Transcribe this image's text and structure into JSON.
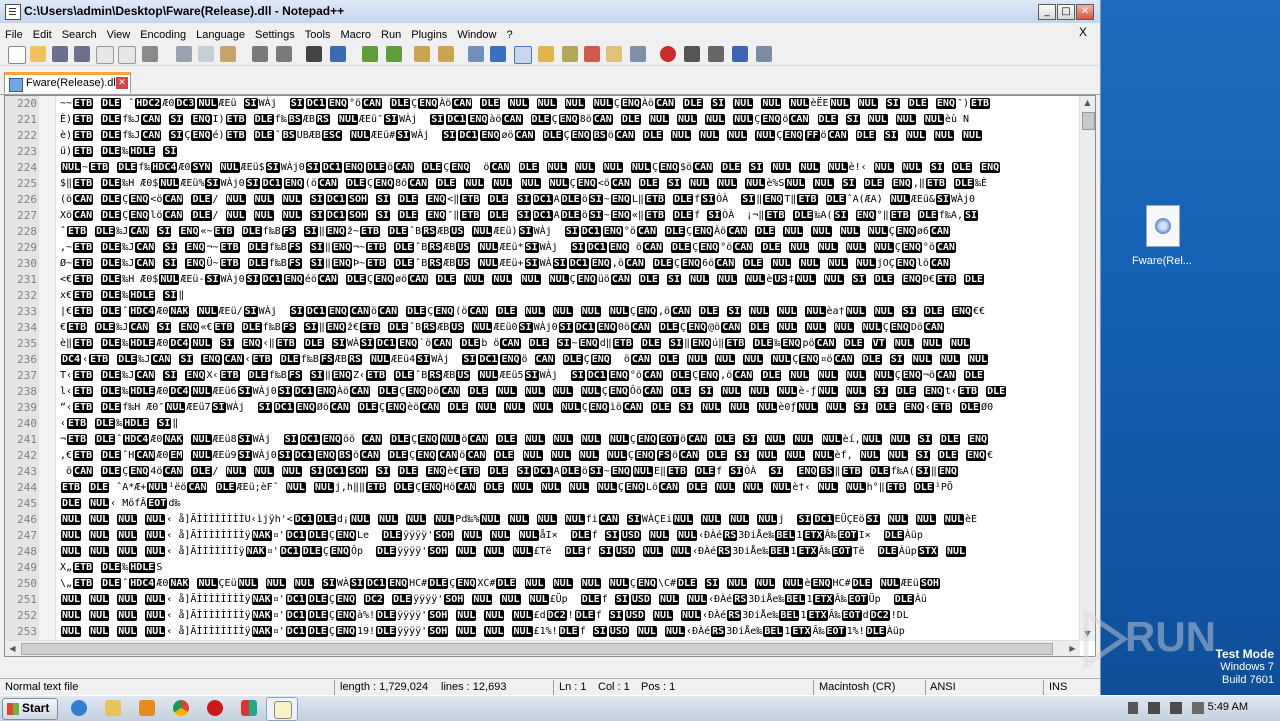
{
  "window": {
    "title": "C:\\Users\\admin\\Desktop\\Fware(Release).dll - Notepad++",
    "controls": {
      "minimize": "_",
      "maximize": "□",
      "close": "✕"
    }
  },
  "menu": {
    "items": [
      "File",
      "Edit",
      "Search",
      "View",
      "Encoding",
      "Language",
      "Settings",
      "Tools",
      "Macro",
      "Run",
      "Plugins",
      "Window",
      "?"
    ],
    "close": "X"
  },
  "toolbar_icons": [
    "new-icon",
    "open-icon",
    "save-icon",
    "save-all-icon",
    "close-icon",
    "close-all-icon",
    "print-icon",
    "cut-icon",
    "copy-icon",
    "paste-icon",
    "undo-icon",
    "redo-icon",
    "find-icon",
    "replace-icon",
    "zoom-in-icon",
    "zoom-out-icon",
    "sync-v-icon",
    "sync-h-icon",
    "wrap-icon",
    "all-chars-icon",
    "indent-guide-icon",
    "udl-icon",
    "doc-map-icon",
    "function-list-icon",
    "folder-workspace-icon",
    "monitor-icon",
    "record-icon",
    "stop-icon",
    "play-icon",
    "play-multi-icon",
    "save-macro-icon"
  ],
  "tab": {
    "label": "Fware(Release).dll"
  },
  "editor": {
    "lines": [
      {
        "num": "220",
        "text": "~~ETB DLE ˆHDC2Æ0DC3NULÆEü SIWÀj  SIDC1ENQ°öCAN DLEÇENQÀöCAN DLE NUL NUL NUL NULÇENQÀöCAN DLE SI NUL NUL NULèËENUL NUL SI DLE ENQ″)ETB"
      },
      {
        "num": "221",
        "text": "È)ETB DLEf‰JCAN SI ENQI)ETB DLEf‰BSÆBRS NULÆEü″SIWÀj  SIDC1ENQàöCAN DLEÇENQ8öCAN DLE NUL NUL NUL NULÇENQöCAN DLE SI NUL NUL NULèù N"
      },
      {
        "num": "222",
        "text": "è)ETB DLEf‰JCAN SIÇENQé)ETB DLEˆBSUBÆBESC NULÆEü#SIWÀj  SIDC1ENQøöCAN DLEÇENQBSöCAN DLE NUL NUL NUL NULÇENQFFöCAN DLE SI NUL NUL NUL"
      },
      {
        "num": "223",
        "text": "ü)ETB DLE‰HDLE SI"
      },
      {
        "num": "224",
        "text": "NUL~ETB DLEf‰HDC4Æ0SYN NULÆEü$SIWÀj0SIDC1ENQDLEöCAN DLEÇENQ  öCAN DLE NUL NUL NUL NULÇENQ$öCAN DLE SI NUL NUL NULè!‹ NUL NUL SI DLE ENQ"
      },
      {
        "num": "225",
        "text": "$‖ETB DLE‰H Æ0$NULÆEü%SIWÀj0SIDC1ENQ(öCAN DLEÇENQ8öCAN DLE NUL NUL NUL NULÇENQ<öCAN DLE SI NUL NUL NULè%SNUL NUL SI DLE ENQ,‖ETB DLE‰È"
      },
      {
        "num": "226",
        "text": "(öCAN DLEÇENQ<öCAN DLE/ NUL NUL NUL SIDC1SOH SI DLE ENQ<‖ETB DLE SIDC1ADLEöSI~ENQL‖ETB DLEfSIÒÀ  SI‖ENQT‖ETB DLEˆA(ÆA) NULÆEü&SIWÀj0"
      },
      {
        "num": "227",
        "text": "XöCAN DLEÇENQlöCAN DLE/ NUL NUL NUL SIDC1SOH SI DLE ENQ″‖ETB DLE SIDC1ADLEöSI~ENQ«‖ETB DLEf SIÒÀ  ¡¬‖ETB DLE‰A(SI ENQ°‖ETB DLEf‰A,SI"
      },
      {
        "num": "228",
        "text": "ˆETB DLE‰JCAN SI ENQ«~ETB DLEf‰BFS SI‖ENQž~ETB DLEˆBRSÆBUS NULÆEü)SIWÀj  SIDC1ENQ°öCAN DLEÇENQÀöCAN DLE NUL NUL NUL NULÇENQø6CAN"
      },
      {
        "num": "229",
        "text": ",~ETB DLE‰JCAN SI ENQ¬~ETB DLEf‰BFS SI‖ENQ¬~ETB DLEˆBRSÆBUS NULÆEü*SIWÀj  SIDC1ENQ öCAN DLEÇENQ°öCAN DLE NUL NUL NUL NULÇENQ°öCAN"
      },
      {
        "num": "230",
        "text": "Ø~ETB DLE‰JCAN SI ENQÜ~ETB DLEf‰BFS SI‖ENQÞ~ETB DLEˆBRSÆBUS NULÆEü+SIWÀSIDC1ENQ,öCAN DLEÇENQ6öCAN DLE NUL NUL NUL NULjOÇENQlöCAN"
      },
      {
        "num": "231",
        "text": "<€ETB DLE‰H Æ0$NULÆEü-SIWÀj0SIDC1ENQéöCAN DLEÇENQøöCAN DLE NUL NUL NUL NULÇENQüöCAN DLE SI NUL NUL NULèUS‡NUL NUL SI DLE ENQÐ€ETB DLE"
      },
      {
        "num": "232",
        "text": "x€ETB DLE‰HDLE SI‖"
      },
      {
        "num": "233",
        "text": "|€ETB DLEˆHDC4Æ0NAK NULÆEü/SIWÀj  SIDC1ENQCANöCAN DLEÇENQ(öCAN DLE NUL NUL NUL NULÇENQ,öCAN DLE SI NUL NUL NULèa†NUL NUL SI DLE ENQ€€"
      },
      {
        "num": "234",
        "text": "€ETB DLE‰JCAN SI ENQ«€ETB DLEf‰BFS SI‖ENQž€ETB DLEˆBRSÆBUS NULÆEü0SIWÀj0SIDC1ENQ0öCAN DLEÇENQ@öCAN DLE NUL NUL NUL NULÇENQDöCAN"
      },
      {
        "num": "235",
        "text": "è‖ETB DLE‰HDLEÆ0DC4NUL SI ENQ‹‖ETB DLE SIWÀSIDC1ENQ`öCAN DLEb öCAN DLE SI~ENQd‖ETB DLE SI‖ENQú‖ETB DLE‰ENQpöCAN DLE VT NUL NUL NUL"
      },
      {
        "num": "236",
        "text": "DC4‹ETB DLE‰JCAN SI ENQCAN‹ETB DLEf‰BFSÆBRS NULÆEü4SIWÀj  SIDC1ENQö CAN DLEÇENQ  öCAN DLE NUL NUL NUL NULÇENQ¤öCAN DLE SI NUL NUL NUL"
      },
      {
        "num": "237",
        "text": "T‹ETB DLE‰JCAN SI ENQX‹ETB DLEf‰BFS SI‖ENQZ‹ETB DLEˆBRSÆBUS NULÆEü5SIWÀj  SIDC1ENQ°öCAN DLEÇENQ,öCAN DLE NUL NUL NUL NULÇENQ¬öCAN DLE"
      },
      {
        "num": "238",
        "text": "l‹ETB DLE‰HDLEÆ0DC4NULÆEü6SIWÀj0SIDC1ENQÀöCAN DLEÇENQÐöCAN DLE NUL NUL NUL NULÇENQÔöCAN DLE SI NUL NUL NULè-ƒNUL NUL SI DLE ENQt‹ETB DLE"
      },
      {
        "num": "239",
        "text": "“‹ETB DLEf‰H Æ0″NULÆEü7SIWÀj  SIDC1ENQØöCAN DLEÇENQèöCAN DLE NUL NUL NUL NULÇENQìöCAN DLE SI NUL NUL NULè0ƒNUL NUL SI DLE ENQ‹ETB DLEØ0"
      },
      {
        "num": "240",
        "text": "‹ETB DLE‰HDLE SI‖"
      },
      {
        "num": "241",
        "text": "¬ETB DLEˆHDC4Æ0NAK NULÆEü8SIWÀj  SIDC1ENQöö CAN DLEÇENQNULöCAN DLE NUL NUL NUL NULÇENQEOTöCAN DLE SI NUL NUL NULèí,NUL NUL SI DLE ENQ"
      },
      {
        "num": "242",
        "text": ",€ETB DLEˆHCANÆ0EM NULÆEü9SIWÀj0SIDC1ENQBSöCAN DLEÇENQCANöCAN DLE NUL NUL NUL NULÇENQFSöCAN DLE SI NUL NUL NULèf, NUL NUL SI DLE ENQ€"
      },
      {
        "num": "243",
        "text": " öCAN DLEÇENQ4öCAN DLE/ NUL NUL NUL SIDC1SOH SI DLE ENQè€ETB DLE SIDC1ADLEöSI~ENQNULE‖ETB DLEf SIÒÀ  SI  ENQBS‖ETB DLEf‰A(SI‖ENQ"
      },
      {
        "num": "244",
        "text": "ETB DLE ˆA*Æ+NUL¹ëöCAN DLEÆEü;èF˜ NUL NULj,h‖‖ETB DLEÇENQHöCAN DLE NUL NUL NUL NULÇENQLöCAN DLE NUL NUL NULè†‹ NUL NULh°‖ETB DLE¹PÕ"
      },
      {
        "num": "245",
        "text": "DLE NUL‹ MöfÂEOTd‰"
      },
      {
        "num": "246",
        "text": "NUL NUL NUL NUL‹ å]ÃÌÌÌÌÌÌÌÌU‹ìjÿh'<DC1DLEd¡NUL NUL NUL NULPd‰%NUL NUL NUL NULfiCAN SIWÀÇEiNUL NUL NUL NULj  SIDC1EÜÇEöSI NUL NUL NULèE"
      },
      {
        "num": "247",
        "text": "NUL NUL NUL NUL‹ å]ÃÌÌÌÌÌÌÌÌÿNAK¤'DC1DLEÇENQLe  DLEÿÿÿÿ'SOH NUL NUL NULåI×  DLEf SIUSD NUL NUL‹ÐÀéRS3ÐiÅe‰BEL1ETXÂ‰EOTI×  DLEÀüp"
      },
      {
        "num": "248",
        "text": "NUL NUL NUL NUL‹ å]ÃÌÌÌÌÌÌÌÿNAK¤'DC1DLEÇENQÔp  DLEÿÿÿÿ'SOH NUL NUL NUL£Të  DLEf SIUSD NUL NUL‹ÐÀéRS3ÐiÅe‰BEL1ETXÂ‰EOTTë  DLEÀüpSTX NUL"
      },
      {
        "num": "249",
        "text": "X„ETB DLE‰HDLES"
      },
      {
        "num": "250",
        "text": "\\„ETB DLEˆHDC4Æ0NAK NULÇEüNUL NUL NUL SIWÀSIDC1ENQHC#DLEÇENQXC#DLE NUL NUL NUL NULÇENQ\\C#DLE SI NUL NUL NULèENQHC#DLE NULÆEüSOH"
      },
      {
        "num": "251",
        "text": "NUL NUL NUL NUL‹ å]ÃÌÌÌÌÌÌÌÌÿNAK¤'DC1DLEÇENQ DC2 DLEÿÿÿÿ'SOH NUL NUL NUL£Üp  DLEf SIUSD NUL NUL‹ÐÀéRS3ÐiÅe‰BEL1ETXÂ‰EOTÜp  DLEÀü"
      },
      {
        "num": "252",
        "text": "NUL NUL NUL NUL‹ å]ÃÌÌÌÌÌÌÌÌÿNAK¤'DC1DLEÇENQà%!DLEÿÿÿÿ'SOH NUL NUL NUL£dDC2!DLEf SIUSD NUL NUL‹ÐÀéRS3ÐiÅe‰BEL1ETXÂ‰EOTdDC2!DL"
      },
      {
        "num": "253",
        "text": "NUL NUL NUL NUL‹ å]ÃÌÌÌÌÌÌÌÌÿNAK¤'DC1DLEÇENQ19!DLEÿÿÿÿ'SOH NUL NUL NUL£1%!DLEf SIUSD NUL NUL‹ÐÀéRS3ÐiÅe‰BEL1ETXÂ‰EOT1%!DLEÀüp"
      },
      {
        "num": "254",
        "text": "‡ETB DLEÇ…¼uÿÿETX NUL NUL NULÇ…Àuÿÿ SI NUL NUL NUL¨…@üÿÿÆ…˜üÿÿ NULÇ…ÀuÿÿBS NUL NUL NUL SI ENQEOT‡ETB DLE SIDC1…Èüÿÿf‰…Èüÿÿ SI‖ENQACK‡ETB"
      }
    ]
  },
  "status": {
    "type": "Normal text file",
    "length": "length : 1,729,024",
    "lines": "lines : 12,693",
    "ln": "Ln : 1",
    "col": "Col : 1",
    "pos": "Pos : 1",
    "eol": "Macintosh (CR)",
    "encoding": "ANSI",
    "mode": "INS"
  },
  "desktop": {
    "icon_label": "Fware(Rel...",
    "watermark": "RUN",
    "testmode_line1": "Test Mode",
    "testmode_line2": "Windows 7",
    "testmode_line3": "Build 7601"
  },
  "taskbar": {
    "start_label": "Start",
    "apps": [
      "ie-icon",
      "explorer-icon",
      "media-player-icon",
      "chrome-icon",
      "opera-icon",
      "app-grid-icon",
      "notepadpp-icon"
    ],
    "clock": "5:49 AM"
  }
}
